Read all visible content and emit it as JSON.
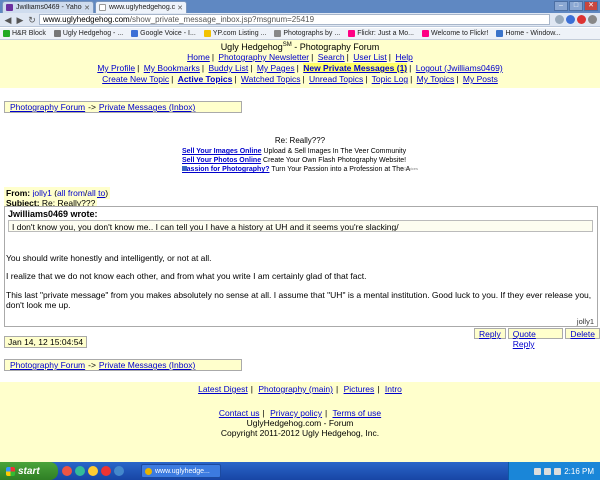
{
  "browser": {
    "tabs": [
      {
        "label": "Jwilliams0469 - Yahoo!",
        "active": false
      },
      {
        "label": "www.uglyhedgehog.com",
        "active": true
      }
    ],
    "url_domain": "www.uglyhedgehog.com",
    "url_path": "/show_private_message_inbox.jsp?msgnum=25419",
    "bookmarks": [
      {
        "label": "H&R Block",
        "icon": "hr-block-icon",
        "color": "#22aa22"
      },
      {
        "label": "Ugly Hedgehog - ...",
        "icon": "hedgehog-icon",
        "color": "#777777"
      },
      {
        "label": "Google Voice - I...",
        "icon": "google-icon",
        "color": "#3b6fd6"
      },
      {
        "label": "YP.com Listing ...",
        "icon": "yp-icon",
        "color": "#f2c200"
      },
      {
        "label": "Photographs by ...",
        "icon": "photo-icon",
        "color": "#888888"
      },
      {
        "label": "Flickr: Just a Mo...",
        "icon": "flickr-icon",
        "color": "#ff0084"
      },
      {
        "label": "Welcome to Flickr!",
        "icon": "flickr-icon",
        "color": "#ff0084"
      },
      {
        "label": "Home - Window...",
        "icon": "windows-icon",
        "color": "#3a73c9"
      }
    ]
  },
  "site": {
    "title": "Ugly Hedgehog",
    "title_mark": "SM",
    "title_suffix": "- Photography Forum",
    "nav_row1": [
      "Home",
      "Photography Newsletter",
      "Search",
      "User List",
      "Help"
    ],
    "nav_row2": [
      "My Profile",
      "My Bookmarks",
      "Buddy List",
      "My Pages",
      "New Private Messages (1)",
      "Logout (Jwilliams0469)"
    ],
    "nav_row3": [
      "Create New Topic",
      "Active Topics",
      "Watched Topics",
      "Unread Topics",
      "Topic Log",
      "My Topics",
      "My Posts"
    ]
  },
  "breadcrumb": {
    "forum": "Photography Forum",
    "arrow": "->",
    "section": "Private Messages (Inbox)"
  },
  "message": {
    "title": "Re: Really???",
    "ads": [
      {
        "link": "Sell Your Images Online",
        "text": "Upload & Sell Images In The Veer Community"
      },
      {
        "link": "Sell Your Photos Online",
        "text": "Create Your Own Flash Photography Website!"
      },
      {
        "link": "Passion for Photography?",
        "text": "Turn Your Passion into a Profession at The A"
      }
    ],
    "ad_footer": "AdChoices",
    "from_label": "From:",
    "from_user": "jolly1",
    "from_all": "all from",
    "to_all": "all to",
    "subject_label": "Subject:",
    "subject": "Re: Really???",
    "quote_author": "Jwilliams0469 wrote:",
    "quote_text": "I don't know you, you don't know me.. I can tell you I have a history at UH and it seems you're slacking/",
    "paragraphs": [
      "You should write honestly and intelligently, or not at all.",
      "I realize that we do not know each other, and from what you write I am certainly glad of that fact.",
      "This last \"private message\" from you makes absolutely no sense at all. I assume that \"UH\" is a mental institution. Good luck to you. If they ever release you, don't look me up."
    ],
    "signature": "jolly1",
    "timestamp": "Jan 14, 12 15:04:54"
  },
  "actions": {
    "reply": "Reply",
    "quote_reply": "Quote Reply",
    "delete": "Delete"
  },
  "footer": {
    "row1": [
      "Latest Digest",
      "Photography (main)",
      "Pictures",
      "Intro"
    ],
    "row2": [
      "Contact us",
      "Privacy policy",
      "Terms of use"
    ],
    "domain": "UglyHedgehog.com - Forum",
    "copyright": "Copyright 2011-2012 Ugly Hedgehog, Inc."
  },
  "taskbar": {
    "start": "start",
    "task": "www.uglyhedge...",
    "clock": "2:16 PM"
  }
}
